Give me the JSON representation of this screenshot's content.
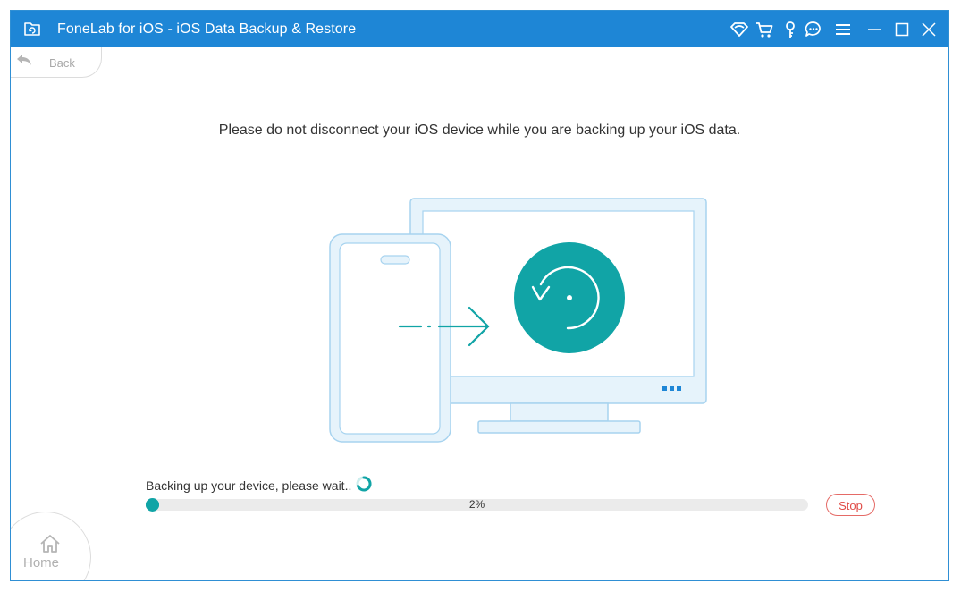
{
  "window": {
    "title": "FoneLab for iOS - iOS Data Backup & Restore",
    "titlebar_color": "#1e86d6",
    "titlebar_icons": [
      "wifi-icon",
      "cart-icon",
      "key-icon",
      "chat-icon",
      "menu-icon",
      "minimize-icon",
      "maximize-icon",
      "close-icon"
    ]
  },
  "nav": {
    "back_label": "Back",
    "home_label": "Home"
  },
  "main": {
    "message": "Please do not disconnect your iOS device while you are backing up your iOS data.",
    "status": "Backing up your device, please wait..",
    "progress": {
      "value": 0.02,
      "label": "2%",
      "fill_color": "#11a4a6"
    },
    "stop_label": "Stop",
    "accent_color": "#11a4a6",
    "danger_color": "#e04d48"
  }
}
